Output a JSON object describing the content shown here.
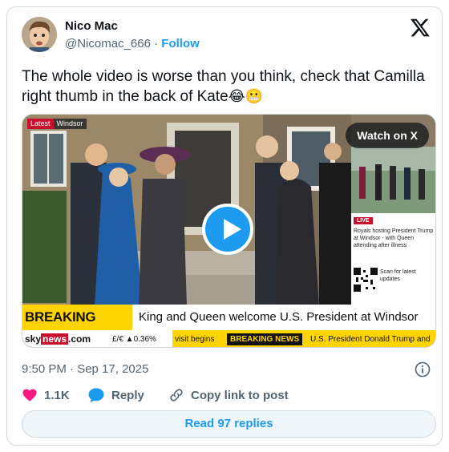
{
  "author": {
    "name": "Nico Mac",
    "handle": "@Nicomac_666",
    "separator": " · ",
    "follow_label": "Follow"
  },
  "tweet": {
    "text": "The whole video is worse than you think, check that Camilla right thumb in the back of Kate",
    "emojis": "😂😬"
  },
  "media": {
    "watch_label": "Watch on X",
    "tag_latest": "Latest",
    "tag_location": "Windsor",
    "live_label": "LIVE",
    "side_text": "Royals hosting President Trump at Windsor - with Queen attending after illness",
    "scan_text": "Scan for latest updates",
    "breaking_label": "BREAKING NEWS",
    "headline": "King and Queen welcome U.S. President at Windsor",
    "ticker_brand_a": "sky",
    "ticker_brand_b": "news",
    "ticker_brand_c": ".com",
    "ticker_fx": "£/€ ▲0.36%",
    "ticker_1": "visit begins",
    "ticker_2": "BREAKING NEWS",
    "ticker_3": "U.S. President Donald Trump and"
  },
  "meta": {
    "timestamp": "9:50 PM · Sep 17, 2025"
  },
  "actions": {
    "likes": "1.1K",
    "reply": "Reply",
    "copy_link": "Copy link to post"
  },
  "read_replies": "Read 97 replies",
  "colors": {
    "accent": "#1d9bf0",
    "like": "#f91880",
    "breaking_yellow": "#ffd400",
    "sky_red": "#c8102e"
  }
}
